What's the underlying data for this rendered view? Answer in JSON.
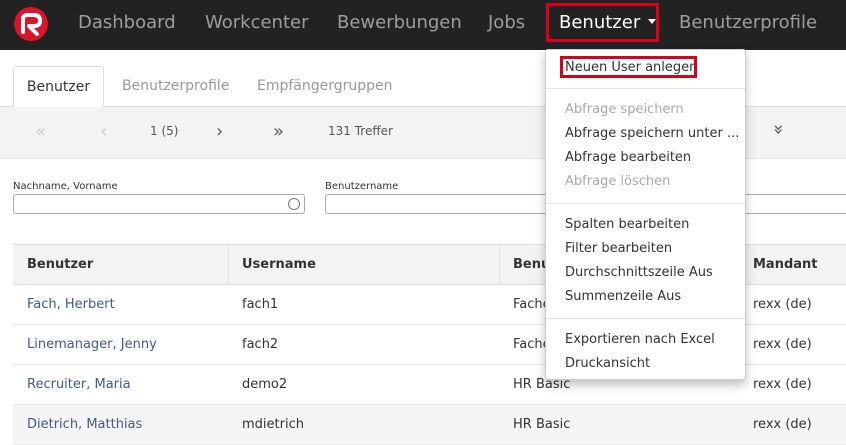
{
  "nav": {
    "items": [
      "Dashboard",
      "Workcenter",
      "Bewerbungen",
      "Jobs",
      "Benutzer",
      "Benutzerprofile"
    ],
    "active": "Benutzer",
    "accent": "#d9001b",
    "logo_color": "#d9142b"
  },
  "tabs": [
    "Benutzer",
    "Benutzerprofile",
    "Empfängergruppen"
  ],
  "pager": {
    "page": "1 (5)",
    "hits": "131 Treffer",
    "first_icon": "double-chevron-left-icon",
    "prev_icon": "chevron-left-icon",
    "next_icon": "chevron-right-icon",
    "last_icon": "double-chevron-right-icon",
    "collapse_icon": "double-chevron-down-icon"
  },
  "filters": {
    "name_label": "Nachname, Vorname",
    "username_label": "Benutzername"
  },
  "table": {
    "columns": [
      "Benutzer",
      "Username",
      "Benu",
      "Mandant"
    ],
    "rows": [
      [
        "Fach, Herbert",
        "fach1",
        "Fache",
        "rexx (de)"
      ],
      [
        "Linemanager, Jenny",
        "fach2",
        "Fache",
        "rexx (de)"
      ],
      [
        "Recruiter, Maria",
        "demo2",
        "HR Basic",
        "rexx (de)"
      ],
      [
        "Dietrich, Matthias",
        "mdietrich",
        "HR Basic",
        "rexx (de)"
      ]
    ]
  },
  "dropdown": {
    "new_user": "Neuen User anlegen",
    "save_query": "Abfrage speichern",
    "save_query_as": "Abfrage speichern unter ...",
    "edit_query": "Abfrage bearbeiten",
    "delete_query": "Abfrage löschen",
    "edit_columns": "Spalten bearbeiten",
    "edit_filter": "Filter bearbeiten",
    "average_row": "Durchschnittszeile Aus",
    "sum_row": "Summenzeile Aus",
    "export_excel": "Exportieren nach Excel",
    "print_view": "Druckansicht"
  }
}
